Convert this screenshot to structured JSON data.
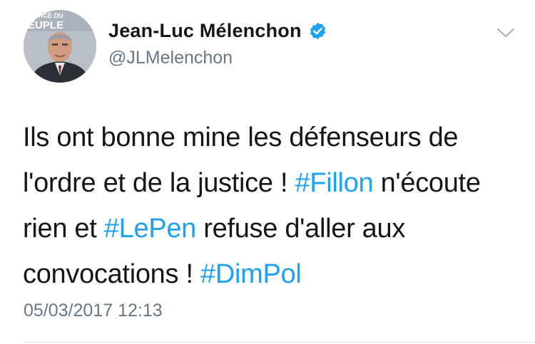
{
  "author": {
    "display_name": "Jean-Luc Mélenchon",
    "handle": "@JLMelenchon",
    "verified": true,
    "avatar_banner_text": [
      "ORCE DU",
      "EUPLE"
    ]
  },
  "tweet": {
    "parts": [
      {
        "text": "Ils ont bonne mine les défenseurs de l'ordre et de la justice ! ",
        "hashtag": false
      },
      {
        "text": "#Fillon",
        "hashtag": true
      },
      {
        "text": " n'écoute rien et ",
        "hashtag": false
      },
      {
        "text": "#LePen",
        "hashtag": true
      },
      {
        "text": " refuse d'aller aux convocations ! ",
        "hashtag": false
      },
      {
        "text": "#DimPol",
        "hashtag": true
      }
    ],
    "timestamp": "05/03/2017 12:13"
  },
  "colors": {
    "link": "#1da1f2",
    "verified_badge": "#1da1f2",
    "secondary_text": "#657786"
  },
  "icons": {
    "menu": "chevron-down-icon",
    "verified": "verified-badge-icon"
  }
}
